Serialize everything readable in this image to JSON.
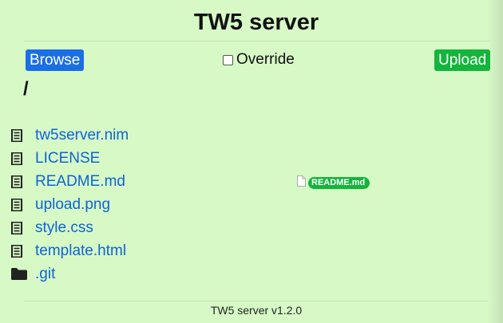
{
  "title": "TW5 server",
  "toolbar": {
    "browse_label": "Browse",
    "override_label": "Override",
    "override_checked": false,
    "upload_label": "Upload"
  },
  "path": "/",
  "files": [
    {
      "name": "tw5server.nim",
      "icon": "document-icon"
    },
    {
      "name": "LICENSE",
      "icon": "document-icon"
    },
    {
      "name": "README.md",
      "icon": "document-icon"
    },
    {
      "name": "upload.png",
      "icon": "document-icon"
    },
    {
      "name": "style.css",
      "icon": "document-icon"
    },
    {
      "name": "template.html",
      "icon": "document-icon"
    },
    {
      "name": ".git",
      "icon": "folder-icon"
    }
  ],
  "drag_preview": {
    "label": "README.md",
    "icon": "blank-file-icon"
  },
  "footer": "TW5 server v1.2.0",
  "colors": {
    "background": "#d6f9c6",
    "link": "#0f63d6",
    "browse_button": "#1a6ee6",
    "upload_button": "#14b53c"
  }
}
